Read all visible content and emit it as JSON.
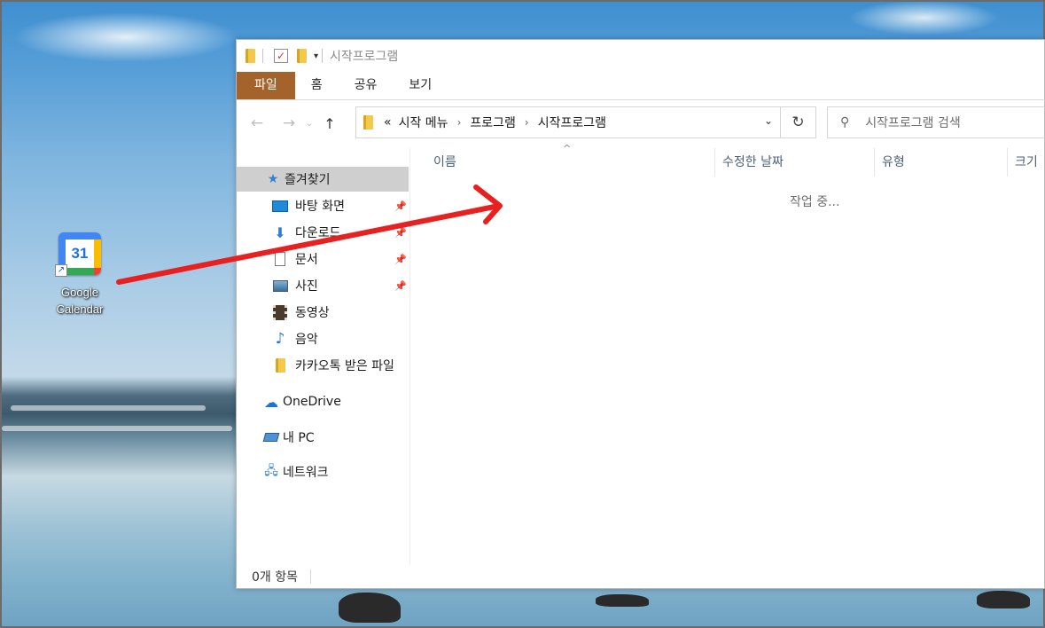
{
  "desktop": {
    "shortcut": {
      "name": "Google Calendar",
      "icon_number": "31",
      "name_line1": "Google",
      "name_line2": "Calendar"
    }
  },
  "explorer": {
    "title": "시작프로그램",
    "ribbon_tabs": [
      "파일",
      "홈",
      "공유",
      "보기"
    ],
    "address": {
      "prefix": "«",
      "crumbs": [
        "시작 메뉴",
        "프로그램",
        "시작프로그램"
      ]
    },
    "search_placeholder": "시작프로그램 검색",
    "nav": {
      "quick_access": "즐겨찾기",
      "items": [
        {
          "label": "바탕 화면",
          "icon": "desktop-icon",
          "pinned": true
        },
        {
          "label": "다운로드",
          "icon": "download-arrow-icon",
          "pinned": true
        },
        {
          "label": "문서",
          "icon": "document-icon",
          "pinned": true
        },
        {
          "label": "사진",
          "icon": "picture-icon",
          "pinned": true
        },
        {
          "label": "동영상",
          "icon": "film-icon",
          "pinned": false
        },
        {
          "label": "음악",
          "icon": "music-note-icon",
          "pinned": false
        },
        {
          "label": "카카오톡 받은 파일",
          "icon": "folder-icon",
          "pinned": false
        }
      ],
      "onedrive": "OneDrive",
      "this_pc": "내 PC",
      "network": "네트워크"
    },
    "columns": [
      "이름",
      "수정한 날짜",
      "유형",
      "크기"
    ],
    "loading_text": "작업 중...",
    "status": "0개 항목"
  },
  "colors": {
    "file_tab": "#a5632c",
    "annotation_arrow": "#e8201f",
    "selected_nav": "#cfcfcf"
  }
}
